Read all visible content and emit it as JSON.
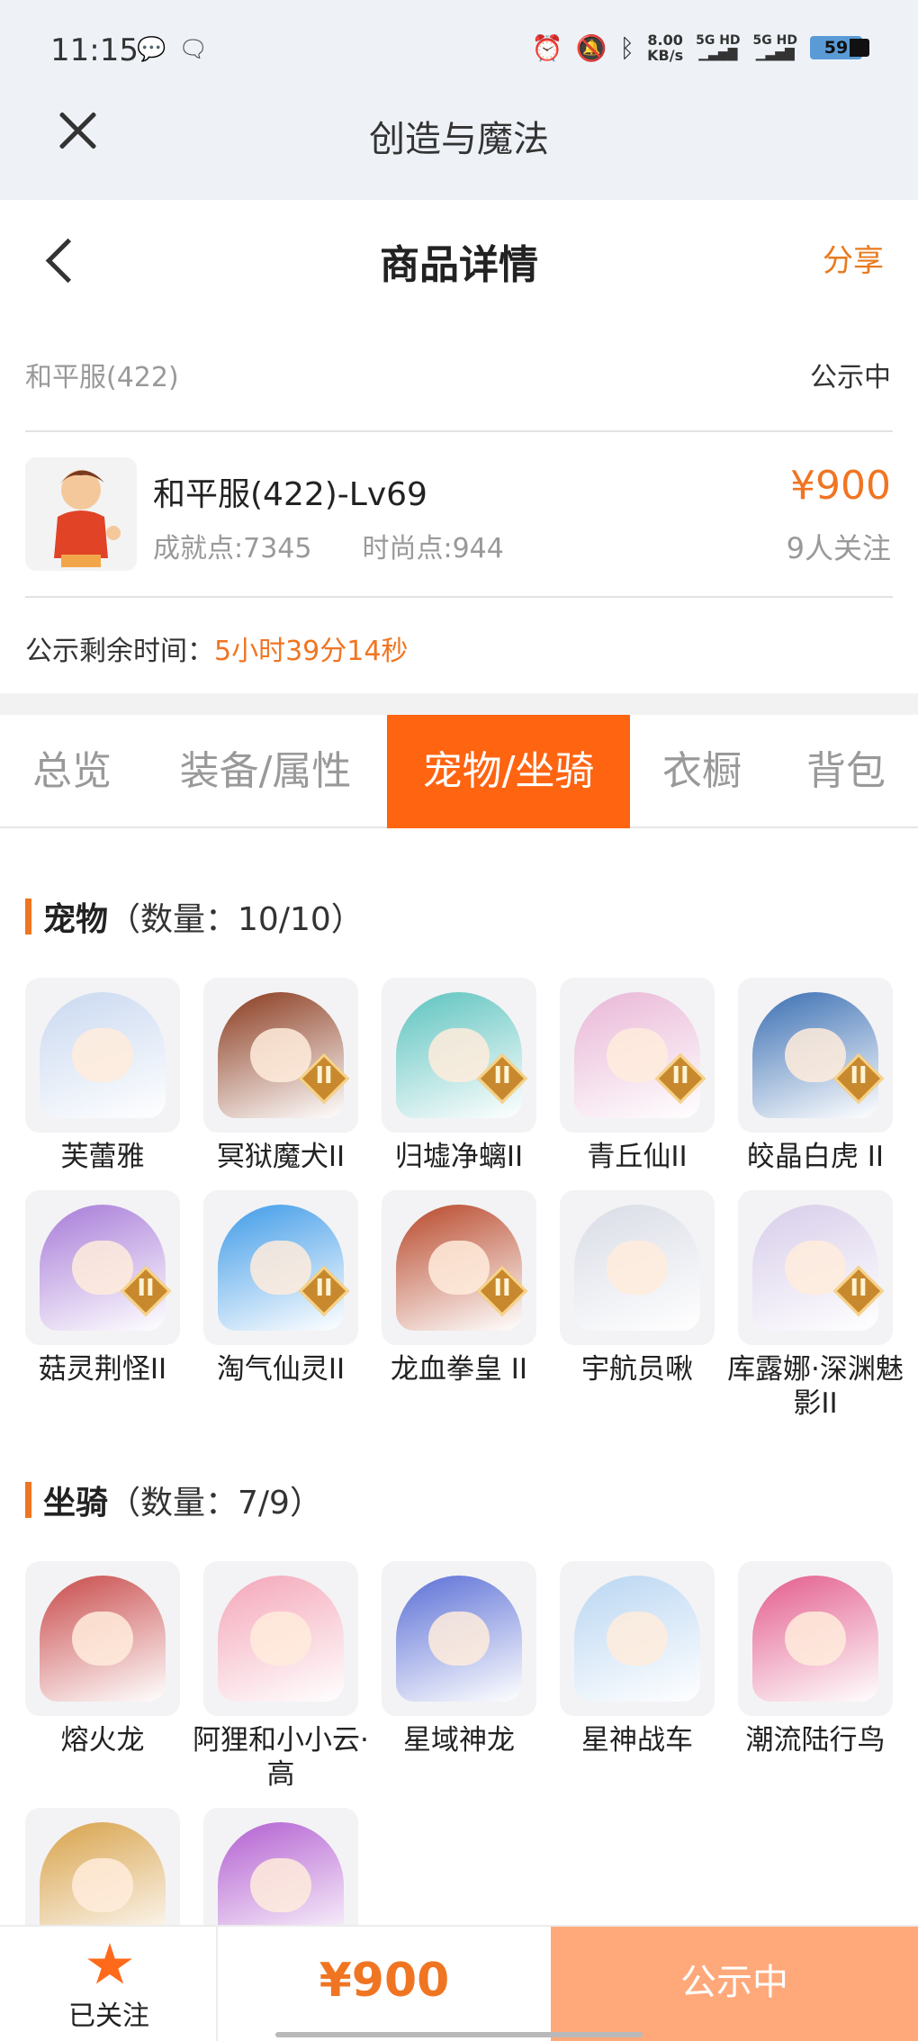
{
  "status_bar": {
    "time": "11:15",
    "net_speed_value": "8.00",
    "net_speed_unit": "KB/s",
    "sim1": "5G HD",
    "sim2": "5G HD",
    "battery": "59"
  },
  "app_bar": {
    "title": "创造与魔法"
  },
  "header": {
    "title": "商品详情",
    "share_label": "分享"
  },
  "listing": {
    "server": "和平服(422)",
    "status": "公示中",
    "character_name": "和平服(422)-Lv69",
    "achievement": "成就点:7345",
    "fashion": "时尚点:944",
    "price": "¥900",
    "followers": "9人关注",
    "remaining_label": "公示剩余时间：",
    "remaining_value": "5小时39分14秒"
  },
  "tabs": [
    {
      "label": "总览"
    },
    {
      "label": "装备/属性"
    },
    {
      "label": "宠物/坐骑"
    },
    {
      "label": "衣橱"
    },
    {
      "label": "背包"
    }
  ],
  "active_tab": "宠物/坐骑",
  "pets": {
    "title": "宠物",
    "count": "（数量：10/10）",
    "items": [
      {
        "name": "芙蕾雅",
        "icon": "pet-portrait-icon",
        "color": "#c9d8f0"
      },
      {
        "name": "冥狱魔犬II",
        "icon": "pet-portrait-icon",
        "color": "#8a3a1e",
        "badge": "II"
      },
      {
        "name": "归墟净螭II",
        "icon": "pet-portrait-icon",
        "color": "#5cc3bf",
        "badge": "II"
      },
      {
        "name": "青丘仙II",
        "icon": "pet-portrait-icon",
        "color": "#e9b6d6",
        "badge": "II"
      },
      {
        "name": "皎晶白虎 II",
        "icon": "pet-portrait-icon",
        "color": "#3a6fb3",
        "badge": "II"
      },
      {
        "name": "菇灵荆怪II",
        "icon": "pet-portrait-icon",
        "color": "#a77bd8",
        "badge": "II"
      },
      {
        "name": "淘气仙灵II",
        "icon": "pet-portrait-icon",
        "color": "#3f9be8",
        "badge": "II"
      },
      {
        "name": "龙血拳皇 II",
        "icon": "pet-portrait-icon",
        "color": "#b8482a",
        "badge": "II"
      },
      {
        "name": "宇航员啾",
        "icon": "pet-portrait-icon",
        "color": "#d9dce6"
      },
      {
        "name": "库露娜·深渊魅影II",
        "icon": "pet-portrait-icon",
        "color": "#d7cdea",
        "badge": "II"
      }
    ]
  },
  "mounts": {
    "title": "坐骑",
    "count": "（数量：7/9）",
    "items": [
      {
        "name": "熔火龙",
        "icon": "mount-portrait-icon",
        "color": "#c94a4a"
      },
      {
        "name": "阿狸和小小云·高",
        "icon": "mount-portrait-icon",
        "color": "#f4a6b8"
      },
      {
        "name": "星域神龙",
        "icon": "mount-portrait-icon",
        "color": "#5b6fd6"
      },
      {
        "name": "星神战车",
        "icon": "mount-portrait-icon",
        "color": "#b9d6f2"
      },
      {
        "name": "潮流陆行鸟",
        "icon": "mount-portrait-icon",
        "color": "#e35c8c"
      },
      {
        "name": "",
        "icon": "mount-portrait-icon",
        "color": "#d8a24a"
      },
      {
        "name": "",
        "icon": "mount-portrait-icon",
        "color": "#b35fd1"
      }
    ]
  },
  "bottom": {
    "follow_label": "已关注",
    "price": "¥900",
    "status_label": "公示中"
  },
  "colors": {
    "accent": "#ff6411",
    "price": "#f07522",
    "status_button": "#ffa87a"
  }
}
